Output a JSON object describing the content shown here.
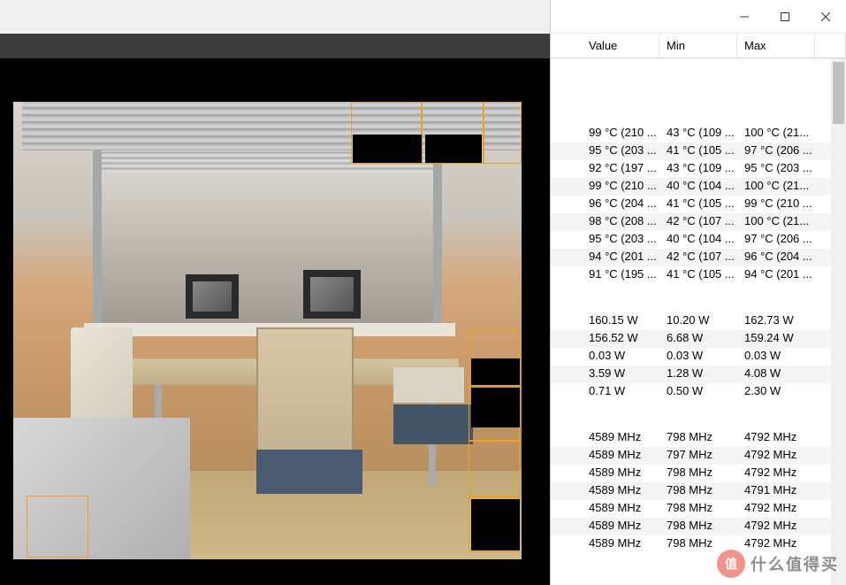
{
  "headers": {
    "value": "Value",
    "min": "Min",
    "max": "Max"
  },
  "groups": [
    {
      "rows": [
        {
          "value": "99 °C  (210 ...",
          "min": "43 °C  (109 ...",
          "max": "100 °C  (21..."
        },
        {
          "value": "95 °C  (203 ...",
          "min": "41 °C  (105 ...",
          "max": "97 °C  (206 ..."
        },
        {
          "value": "92 °C  (197 ...",
          "min": "43 °C  (109 ...",
          "max": "95 °C  (203 ..."
        },
        {
          "value": "99 °C  (210 ...",
          "min": "40 °C  (104 ...",
          "max": "100 °C  (21..."
        },
        {
          "value": "96 °C  (204 ...",
          "min": "41 °C  (105 ...",
          "max": "99 °C  (210 ..."
        },
        {
          "value": "98 °C  (208 ...",
          "min": "42 °C  (107 ...",
          "max": "100 °C  (21..."
        },
        {
          "value": "95 °C  (203 ...",
          "min": "40 °C  (104 ...",
          "max": "97 °C  (206 ..."
        },
        {
          "value": "94 °C  (201 ...",
          "min": "42 °C  (107 ...",
          "max": "96 °C  (204 ..."
        },
        {
          "value": "91 °C  (195 ...",
          "min": "41 °C  (105 ...",
          "max": "94 °C  (201 ..."
        }
      ]
    },
    {
      "rows": [
        {
          "value": "160.15 W",
          "min": "10.20 W",
          "max": "162.73 W"
        },
        {
          "value": "156.52 W",
          "min": "6.68 W",
          "max": "159.24 W"
        },
        {
          "value": "0.03 W",
          "min": "0.03 W",
          "max": "0.03 W"
        },
        {
          "value": "3.59 W",
          "min": "1.28 W",
          "max": "4.08 W"
        },
        {
          "value": "0.71 W",
          "min": "0.50 W",
          "max": "2.30 W"
        }
      ]
    },
    {
      "rows": [
        {
          "value": "4589 MHz",
          "min": "798 MHz",
          "max": "4792 MHz"
        },
        {
          "value": "4589 MHz",
          "min": "797 MHz",
          "max": "4792 MHz"
        },
        {
          "value": "4589 MHz",
          "min": "798 MHz",
          "max": "4792 MHz"
        },
        {
          "value": "4589 MHz",
          "min": "798 MHz",
          "max": "4791 MHz"
        },
        {
          "value": "4589 MHz",
          "min": "798 MHz",
          "max": "4792 MHz"
        },
        {
          "value": "4589 MHz",
          "min": "798 MHz",
          "max": "4792 MHz"
        },
        {
          "value": "4589 MHz",
          "min": "798 MHz",
          "max": "4792 MHz"
        }
      ]
    }
  ],
  "watermark": {
    "badge": "值",
    "text": "什么值得买"
  }
}
